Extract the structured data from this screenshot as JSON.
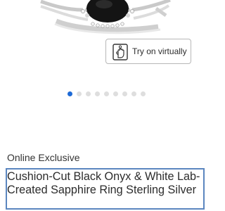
{
  "product": {
    "badge": "Online Exclusive",
    "title": "Cushion-Cut Black Onyx & White Lab-Created Sapphire Ring Sterling Silver"
  },
  "try_on": {
    "label": "Try on virtually",
    "icon": "hand-ring-icon"
  },
  "carousel": {
    "total_images": 9,
    "active_index": 0,
    "active_color": "#1e6ad6",
    "inactive_color": "#dedede"
  },
  "colors": {
    "accent": "#1e6ad6",
    "title_border": "#5b86bf"
  }
}
